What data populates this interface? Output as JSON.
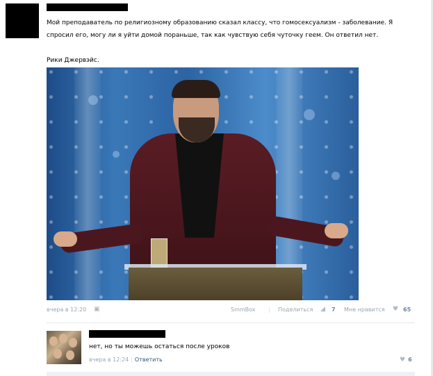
{
  "post": {
    "text_line1": "Мой преподаватель по религиозному образованию сказал классу, что гомосексуализм - заболевание. Я",
    "text_line2": "спросил его, могу ли я уйти домой пораньше, так как чувствую себя чуточку геем. Он ответил нет.",
    "signature": "Рики Джервэйс.",
    "timestamp": "вчера в 12:20",
    "camera_icon": "camera-icon",
    "source_label": "SmmBox",
    "share_label": "Поделиться",
    "share_count": "7",
    "like_label": "Мне нравится",
    "like_count": "65"
  },
  "comment": {
    "text": "нет, но ты можешь остаться после уроков",
    "timestamp": "вчера в 12:24",
    "reply_label": "Ответить",
    "like_count": "6"
  },
  "colors": {
    "link": "#2b587a",
    "meta": "#9aa5b3",
    "count": "#6e86a6"
  }
}
